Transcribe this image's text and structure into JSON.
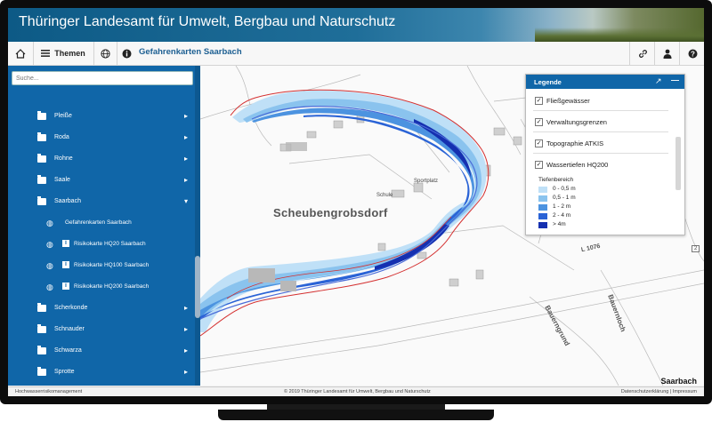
{
  "header": {
    "title": "Thüringer Landesamt für Umwelt, Bergbau und Naturschutz"
  },
  "toolbar": {
    "home_icon": "home-icon",
    "themes_label": "Themen",
    "globe_icon": "globe-icon",
    "info_icon": "info-icon",
    "current_map": "Gefahrenkarten Saarbach",
    "right_icons": [
      "link-icon",
      "person-icon",
      "help-icon"
    ]
  },
  "sidebar": {
    "search_placeholder": "Suche...",
    "items": [
      {
        "label": "Pleiße"
      },
      {
        "label": "Roda"
      },
      {
        "label": "Rohne"
      },
      {
        "label": "Saale"
      },
      {
        "label": "Saarbach"
      },
      {
        "label": "Scherkonde"
      },
      {
        "label": "Schnauder"
      },
      {
        "label": "Schwarza"
      },
      {
        "label": "Sprotte"
      }
    ],
    "subitems": [
      {
        "label": "Gefahrenkarten Saarbach",
        "has_info": false
      },
      {
        "label": "Risikokarte HQ20 Saarbach",
        "has_info": true
      },
      {
        "label": "Risikokarte HQ100 Saarbach",
        "has_info": true
      },
      {
        "label": "Risikokarte HQ200 Saarbach",
        "has_info": true
      }
    ]
  },
  "map": {
    "place_name": "Scheubengrobsdorf",
    "labels": {
      "schule": "Schule",
      "sportplatz": "Sportplatz",
      "road_l": "L 1076",
      "bauerngrund": "Bauerngrund",
      "bauernloch": "Bauernloch",
      "marker": "2"
    },
    "scale_label": "Saarbach"
  },
  "legend": {
    "title": "Legende",
    "layers": [
      {
        "label": "Fließgewässer",
        "checked": true
      },
      {
        "label": "Verwaltungsgrenzen",
        "checked": true
      },
      {
        "label": "Topographie ATKIS",
        "checked": true
      },
      {
        "label": "Wassertiefen HQ200",
        "checked": true
      }
    ],
    "depth_title": "Tiefenbereich",
    "depth_classes": [
      {
        "label": "0 - 0,5 m",
        "color": "#bfe0f7"
      },
      {
        "label": "0,5 - 1 m",
        "color": "#8ac3ee"
      },
      {
        "label": "1 - 2 m",
        "color": "#4c93e0"
      },
      {
        "label": "2 - 4 m",
        "color": "#2a63d6"
      },
      {
        "label": "> 4m",
        "color": "#1530b0"
      }
    ]
  },
  "footer": {
    "left": "Hochwasserrisikomanagement",
    "center": "© 2019 Thüringer Landesamt für Umwelt, Bergbau und Naturschutz",
    "right": "Datenschutzerklärung  |  Impressum"
  },
  "colors": {
    "header_blue": "#0d5a86",
    "sidebar_blue": "#1066a8",
    "accent": "#1c5f92"
  }
}
